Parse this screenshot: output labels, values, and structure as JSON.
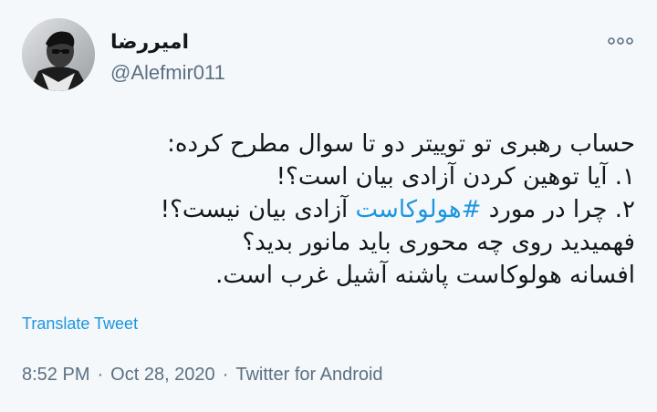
{
  "user": {
    "display_name": "امیررضا",
    "username": "@Alefmir011"
  },
  "more_icon": "more-horizontal-icon",
  "tweet": {
    "lines": [
      "حساب رهبری تو توییتر دو تا سوال مطرح کرده:",
      "۱. آیا توهین کردن آزادی بیان است؟!",
      "۲. چرا در مورد",
      "#هولوکاست",
      "آزادی بیان نیست؟!",
      "فهمیدید روی چه محوری باید مانور بدید؟",
      "افسانه هولوکاست پاشنه آشیل غرب است."
    ]
  },
  "translate_label": "Translate Tweet",
  "meta": {
    "time": "8:52 PM",
    "separator": "·",
    "date": "Oct 28, 2020",
    "source": "Twitter for Android"
  },
  "colors": {
    "link": "#1b95e0",
    "secondary_text": "#5b7083",
    "primary_text": "#14171a",
    "background": "#f5f8fa"
  }
}
